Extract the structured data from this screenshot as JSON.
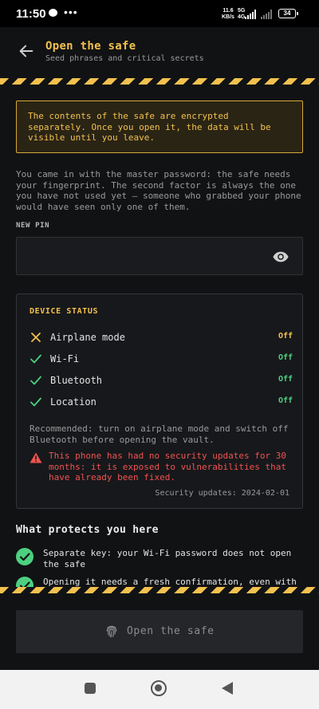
{
  "status_bar": {
    "time": "11:50",
    "net_speed_value": "11.6",
    "net_speed_unit": "KB/s",
    "network_type": "5G",
    "network_type_sub": "4G",
    "battery": "34"
  },
  "header": {
    "title": "Open the safe",
    "subtitle": "Seed phrases and critical secrets"
  },
  "notice": {
    "text": "The contents of the safe are encrypted separately. Once you open it, the data will be visible until you leave."
  },
  "intro_text": "You came in with the master password: the safe needs your fingerprint. The second factor is always the one you have not used yet — someone who grabbed your phone would have seen only one of them.",
  "pin": {
    "label": "NEW PIN",
    "placeholder": "",
    "value": ""
  },
  "device_status": {
    "title": "DEVICE STATUS",
    "rows": [
      {
        "label": "Airplane mode",
        "value": "Off",
        "icon": "cross-icon",
        "color": "#f2c14e"
      },
      {
        "label": "Wi-Fi",
        "value": "Off",
        "icon": "check-icon",
        "color": "#4cd080"
      },
      {
        "label": "Bluetooth",
        "value": "Off",
        "icon": "check-icon",
        "color": "#4cd080"
      },
      {
        "label": "Location",
        "value": "Off",
        "icon": "check-icon",
        "color": "#4cd080"
      }
    ],
    "recommendation": "Recommended: turn on airplane mode and switch off Bluetooth before opening the vault.",
    "warning": "This phone has had no security updates for 30 months: it is exposed to vulnerabilities that have already been fixed.",
    "security_updates": "Security updates: 2024-02-01"
  },
  "protections": {
    "title": "What protects you here",
    "items": [
      {
        "text": "Separate key: your Wi-Fi password does not open the safe"
      },
      {
        "text": "Opening it needs a fresh confirmation, even with"
      }
    ]
  },
  "footer": {
    "open_label": "Open the safe"
  },
  "colors": {
    "accent": "#f2c14e",
    "ok": "#4cd080",
    "danger": "#ef5350",
    "background": "#111214"
  }
}
